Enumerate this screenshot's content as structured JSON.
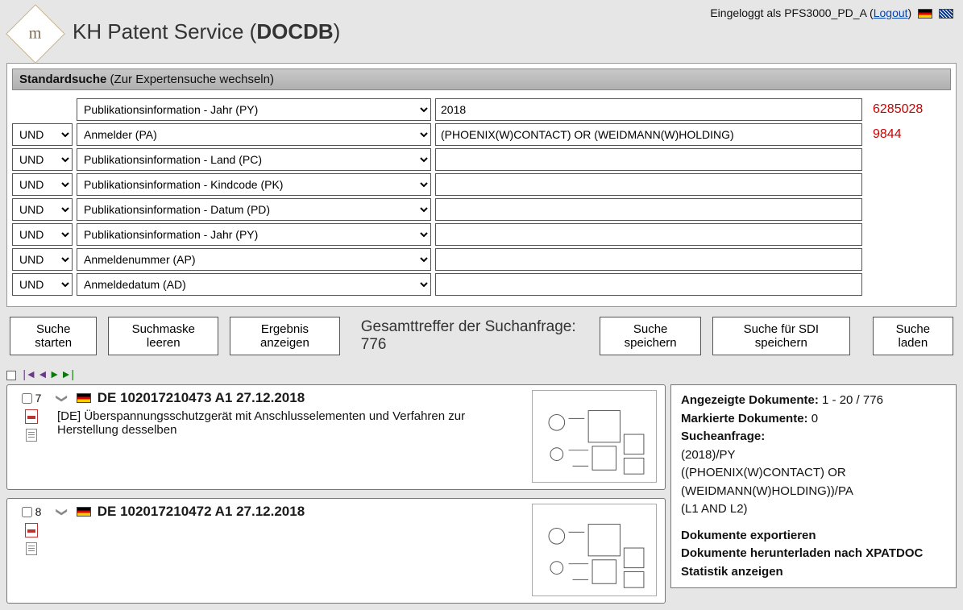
{
  "header": {
    "title_prefix": "KH Patent Service (",
    "title_bold": "DOCDB",
    "title_suffix": ")",
    "logged_in_prefix": "Eingeloggt als ",
    "user": "PFS3000_PD_A",
    "logout": "Logout"
  },
  "tabbar": {
    "bold": "Standardsuche",
    "rest": " (Zur Expertensuche wechseln)"
  },
  "operators": {
    "options": [
      "UND"
    ]
  },
  "rows": [
    {
      "show_op": false,
      "field": "Publikationsinformation - Jahr (PY)",
      "value": "2018",
      "count": "6285028"
    },
    {
      "show_op": true,
      "field": "Anmelder (PA)",
      "value": "(PHOENIX(W)CONTACT) OR (WEIDMANN(W)HOLDING)",
      "count": "9844"
    },
    {
      "show_op": true,
      "field": "Publikationsinformation - Land (PC)",
      "value": "",
      "count": ""
    },
    {
      "show_op": true,
      "field": "Publikationsinformation - Kindcode (PK)",
      "value": "",
      "count": ""
    },
    {
      "show_op": true,
      "field": "Publikationsinformation - Datum (PD)",
      "value": "",
      "count": ""
    },
    {
      "show_op": true,
      "field": "Publikationsinformation - Jahr (PY)",
      "value": "",
      "count": ""
    },
    {
      "show_op": true,
      "field": "Anmeldenummer (AP)",
      "value": "",
      "count": ""
    },
    {
      "show_op": true,
      "field": "Anmeldedatum (AD)",
      "value": "",
      "count": ""
    }
  ],
  "buttons": {
    "start": "Suche starten",
    "clear": "Suchmaske leeren",
    "show": "Ergebnis anzeigen",
    "total_label": "Gesamttreffer der Suchanfrage: ",
    "total_value": "776",
    "save": "Suche speichern",
    "save_sdi": "Suche für SDI speichern",
    "load": "Suche laden"
  },
  "results": [
    {
      "num": "7",
      "title": "DE 102017210473 A1 27.12.2018",
      "desc": "[DE] Überspannungsschutzgerät mit Anschlusselementen und Verfahren zur Herstellung desselben"
    },
    {
      "num": "8",
      "title": "DE 102017210472 A1 27.12.2018",
      "desc": ""
    }
  ],
  "side": {
    "displayed_label": "Angezeigte Dokumente:",
    "displayed_value": " 1 - 20 / 776",
    "marked_label": "Markierte Dokumente:",
    "marked_value": " 0",
    "query_label": "Sucheanfrage:",
    "q1": "(2018)/PY",
    "q2": "((PHOENIX(W)CONTACT) OR (WEIDMANN(W)HOLDING))/PA",
    "q3": "(L1 AND L2)",
    "export": "Dokumente exportieren",
    "download": "Dokumente herunterladen nach XPATDOC",
    "stats": "Statistik anzeigen"
  }
}
